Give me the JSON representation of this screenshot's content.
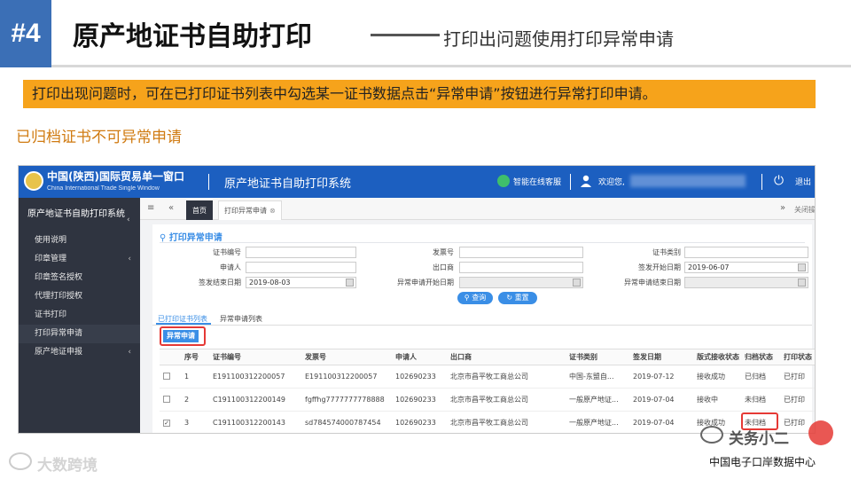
{
  "slide": {
    "badge": "#4",
    "title": "原产地证书自助打印",
    "subtitle": "打印出问题使用打印异常申请",
    "instruction": "打印出现问题时，可在已打印证书列表中勾选某一证书数据点击“异常申请”按钮进行异常打印申请。",
    "note": "已归档证书不可异常申请"
  },
  "app": {
    "brand": "中国(陕西)国际贸易单一窗口",
    "brand_en": "China International Trade Single Window",
    "system_name": "原产地证书自助打印系统",
    "service": "智能在线客服",
    "welcome": "欢迎您,",
    "logout": "退出",
    "icons": [
      "robot-icon",
      "user-icon",
      "power-icon",
      "menu-icon",
      "back-icon",
      "forward-icon",
      "calendar-icon",
      "search-icon",
      "refresh-icon"
    ]
  },
  "sidebar": {
    "header": "原产地证书自助打印系统",
    "items": [
      {
        "label": "使用说明",
        "arrow": ""
      },
      {
        "label": "印章管理",
        "arrow": "‹"
      },
      {
        "label": "印章签名授权",
        "arrow": ""
      },
      {
        "label": "代理打印授权",
        "arrow": ""
      },
      {
        "label": "证书打印",
        "arrow": ""
      },
      {
        "label": "打印异常申请",
        "arrow": ""
      },
      {
        "label": "原产地证申报",
        "arrow": "‹"
      }
    ]
  },
  "tabs": {
    "home": "首页",
    "current": "打印异常申请",
    "close_ops": "关闭操作"
  },
  "query": {
    "title": "打印异常申请",
    "fields": {
      "cert_no": {
        "label": "证书编号",
        "value": ""
      },
      "invoice_no": {
        "label": "发票号",
        "value": ""
      },
      "cert_type": {
        "label": "证书类别",
        "value": ""
      },
      "applicant": {
        "label": "申请人",
        "value": ""
      },
      "exporter": {
        "label": "出口商",
        "value": ""
      },
      "issue_start": {
        "label": "签发开始日期",
        "value": "2019-06-07"
      },
      "issue_end": {
        "label": "签发结束日期",
        "value": "2019-08-03"
      },
      "abn_start": {
        "label": "异常申请开始日期",
        "value": ""
      },
      "abn_end": {
        "label": "异常申请结束日期",
        "value": ""
      }
    },
    "search_btn": "查询",
    "reset_btn": "重置"
  },
  "list": {
    "subtabs": [
      "已打印证书列表",
      "异常申请列表"
    ],
    "abnormal_btn": "异常申请",
    "columns": [
      "序号",
      "证书编号",
      "发票号",
      "申请人",
      "出口商",
      "证书类别",
      "签发日期",
      "版式接收状态",
      "归档状态",
      "打印状态"
    ],
    "rows": [
      {
        "checked": false,
        "seq": "1",
        "cert_no": "E191100312200057",
        "invoice": "E191100312200057",
        "applicant": "102690233",
        "exporter": "北京市昌平牧工商总公司",
        "type": "中国-东盟自...",
        "date": "2019-07-12",
        "recv": "接收成功",
        "archive": "已归档",
        "print": "已打印"
      },
      {
        "checked": false,
        "seq": "2",
        "cert_no": "C191100312200149",
        "invoice": "fgffhg7777777778888",
        "applicant": "102690233",
        "exporter": "北京市昌平牧工商总公司",
        "type": "一般原产地证...",
        "date": "2019-07-04",
        "recv": "接收中",
        "archive": "未归档",
        "print": "已打印"
      },
      {
        "checked": true,
        "seq": "3",
        "cert_no": "C191100312200143",
        "invoice": "sd784574000787454",
        "applicant": "102690233",
        "exporter": "北京市昌平牧工商总公司",
        "type": "一般原产地证...",
        "date": "2019-07-04",
        "recv": "接收成功",
        "archive": "未归档",
        "print": "已打印"
      }
    ]
  },
  "watermark": {
    "left": "大数跨境",
    "right": "关务小二",
    "center": "中国电子口岸数据中心"
  },
  "colors": {
    "badge_blue": "#3b6fb6",
    "orange": "#f6a31b",
    "note_orange": "#d07b12",
    "app_blue": "#1c5fc0",
    "sidebar_dark": "#2f3440",
    "accent_blue": "#3a8ee6",
    "highlight_red": "#e53935"
  }
}
